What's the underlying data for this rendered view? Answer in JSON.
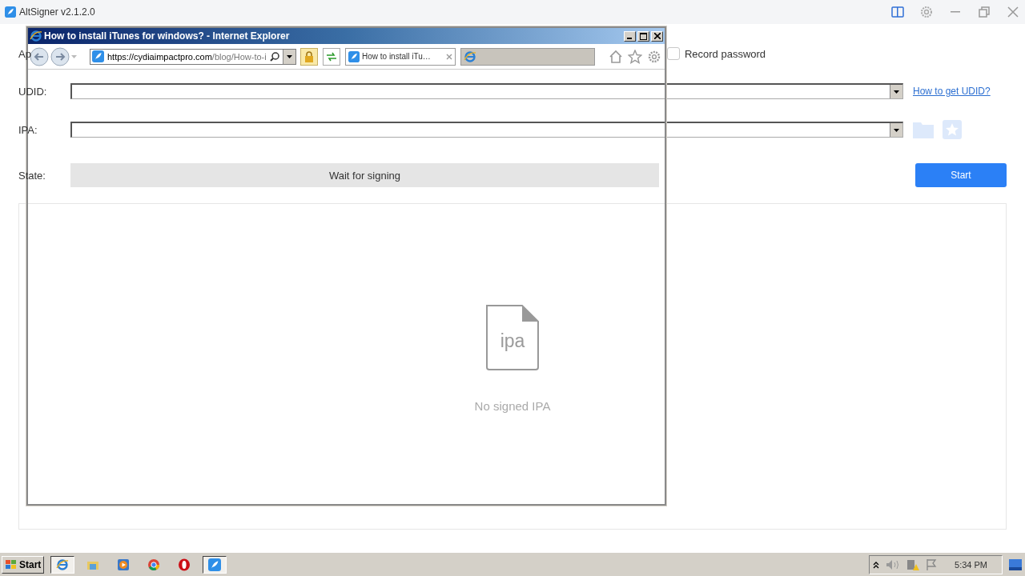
{
  "app": {
    "title": "AltSigner v2.1.2.0",
    "account_label": "Ap",
    "record_password": {
      "label": "Record password",
      "checked": false
    },
    "udid": {
      "label": "UDID:",
      "link": "How to get UDID?"
    },
    "ipa": {
      "label": "IPA:"
    },
    "state": {
      "label": "State:",
      "value": "Wait for signing"
    },
    "start_button": "Start",
    "empty_state": {
      "icon_text": "ipa",
      "message": "No signed IPA"
    }
  },
  "browser": {
    "title": "How to install iTunes for windows? - Internet Explorer",
    "address_host": "https://cydiaimpactpro.com",
    "address_path": "/blog/How-to-i",
    "tabs": [
      {
        "label": "How to install iTu…",
        "selected": true
      },
      {
        "selected": false
      }
    ]
  },
  "taskbar": {
    "start": "Start",
    "clock": "5:34 PM",
    "items": [
      {
        "kind": "ie",
        "active": true
      },
      {
        "kind": "explorer",
        "active": false
      },
      {
        "kind": "media",
        "active": false
      },
      {
        "kind": "chrome",
        "active": false
      },
      {
        "kind": "opera",
        "active": false
      },
      {
        "kind": "altsigner",
        "active": true
      }
    ]
  }
}
